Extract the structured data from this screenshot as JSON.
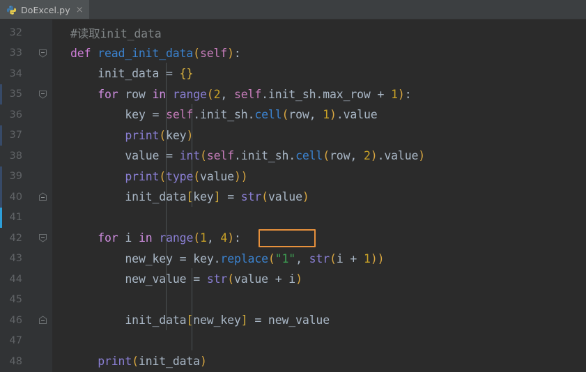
{
  "window": {
    "app": "pycharm-editor",
    "background": "#2b2b2b",
    "gutter_background": "#313335",
    "tabbar_background": "#3c3f41"
  },
  "tab_bar": {
    "tabs": [
      {
        "label": "DoExcel.py",
        "icon": "python-file-icon",
        "close_icon": "×",
        "active": true
      }
    ]
  },
  "editor": {
    "language": "Python",
    "first_visible_line": 32,
    "last_visible_line": 48,
    "find_highlight": {
      "text": "(1, 4):",
      "color": "#e8913c",
      "line": 42
    },
    "lines": [
      {
        "number": "32",
        "fold": "none",
        "vcs": "none",
        "text": "#读取init_data"
      },
      {
        "number": "33",
        "fold": "minus",
        "vcs": "none",
        "text": "def read_init_data(self):"
      },
      {
        "number": "34",
        "fold": "none",
        "vcs": "none",
        "text": "    init_data = {}"
      },
      {
        "number": "35",
        "fold": "minus",
        "vcs": "changed",
        "text": "    for row in range(2, self.init_sh.max_row + 1):"
      },
      {
        "number": "36",
        "fold": "none",
        "vcs": "none",
        "text": "        key = self.init_sh.cell(row, 1).value"
      },
      {
        "number": "37",
        "fold": "none",
        "vcs": "changed",
        "text": "        print(key)"
      },
      {
        "number": "38",
        "fold": "none",
        "vcs": "none",
        "text": "        value = int(self.init_sh.cell(row, 2).value)"
      },
      {
        "number": "39",
        "fold": "none",
        "vcs": "changed",
        "text": "        print(type(value))"
      },
      {
        "number": "40",
        "fold": "end",
        "vcs": "changed",
        "text": "        init_data[key] = str(value)"
      },
      {
        "number": "41",
        "fold": "none",
        "vcs": "added",
        "text": ""
      },
      {
        "number": "42",
        "fold": "minus",
        "vcs": "none",
        "text": "    for i in range(1, 4):"
      },
      {
        "number": "43",
        "fold": "none",
        "vcs": "none",
        "text": "        new_key = key.replace(\"1\", str(i + 1))"
      },
      {
        "number": "44",
        "fold": "none",
        "vcs": "none",
        "text": "        new_value = str(value + i)"
      },
      {
        "number": "45",
        "fold": "none",
        "vcs": "none",
        "text": ""
      },
      {
        "number": "46",
        "fold": "end",
        "vcs": "none",
        "text": "        init_data[new_key] = new_value"
      },
      {
        "number": "47",
        "fold": "none",
        "vcs": "none",
        "text": ""
      },
      {
        "number": "48",
        "fold": "none",
        "vcs": "none",
        "text": "    print(init_data)"
      }
    ]
  },
  "theme_colors": {
    "keyword": "#cf8ee0",
    "def_keyword": "#cc7dd6",
    "function_name": "#2f7fd8",
    "builtin": "#8a7fd4",
    "self": "#c77dbb",
    "number": "#c9a227",
    "string": "#3d9e52",
    "paren": "#d9a741",
    "bracket": "#d9b13e",
    "comment": "#7f8486",
    "text": "#a9b7c6",
    "line_number": "#606366",
    "find_border": "#e8913c"
  }
}
